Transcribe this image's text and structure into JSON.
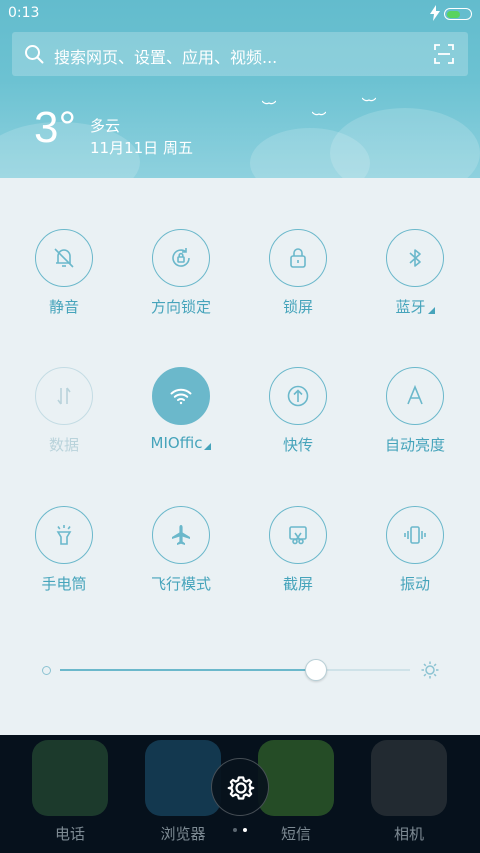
{
  "status_bar": {
    "time": "0:13",
    "battery_level": 0.6,
    "charging": true
  },
  "search": {
    "placeholder": "搜索网页、设置、应用、视频..."
  },
  "weather": {
    "temperature": "3°",
    "condition": "多云",
    "date": "11月11日 周五"
  },
  "quick_settings": [
    {
      "label": "静音",
      "icon": "bell-off-icon",
      "state": "off"
    },
    {
      "label": "方向锁定",
      "icon": "rotation-lock-icon",
      "state": "off"
    },
    {
      "label": "锁屏",
      "icon": "lock-icon",
      "state": "off"
    },
    {
      "label": "蓝牙",
      "icon": "bluetooth-icon",
      "state": "off",
      "has_menu": true
    },
    {
      "label": "数据",
      "icon": "mobile-data-icon",
      "state": "disabled"
    },
    {
      "label": "MIOffic",
      "icon": "wifi-icon",
      "state": "on",
      "has_menu": true
    },
    {
      "label": "快传",
      "icon": "quick-transfer-icon",
      "state": "off"
    },
    {
      "label": "自动亮度",
      "icon": "auto-brightness-icon",
      "state": "off"
    },
    {
      "label": "手电筒",
      "icon": "flashlight-icon",
      "state": "off"
    },
    {
      "label": "飞行模式",
      "icon": "airplane-icon",
      "state": "off"
    },
    {
      "label": "截屏",
      "icon": "screenshot-icon",
      "state": "off"
    },
    {
      "label": "振动",
      "icon": "vibrate-icon",
      "state": "off"
    }
  ],
  "brightness": {
    "level": 0.73
  },
  "home_apps": [
    {
      "label": "电话",
      "icon": "phone-app-icon",
      "color": "#2f5d3a"
    },
    {
      "label": "浏览器",
      "icon": "browser-app-icon",
      "color": "#1f5a7a"
    },
    {
      "label": "短信",
      "icon": "messages-app-icon",
      "color": "#3f7d2f"
    },
    {
      "label": "相机",
      "icon": "camera-app-icon",
      "color": "#3a3f44"
    }
  ],
  "colors": {
    "accent": "#6bb8cb",
    "panel": "#eaf1f4",
    "header": "#6cc2d2"
  }
}
